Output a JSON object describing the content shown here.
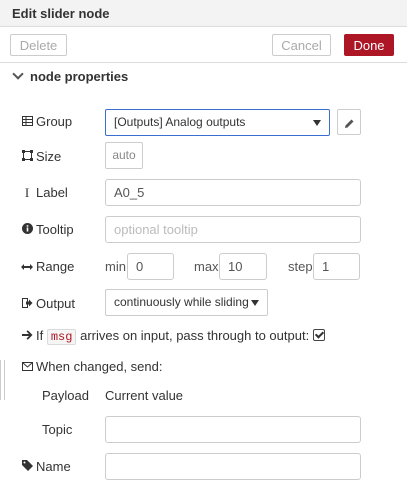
{
  "tray": {
    "title": "Edit slider node"
  },
  "toolbar": {
    "delete_label": "Delete",
    "cancel_label": "Cancel",
    "done_label": "Done"
  },
  "section": {
    "title": "node properties"
  },
  "fields": {
    "group": {
      "label": "Group",
      "value": "[Outputs] Analog outputs"
    },
    "size": {
      "label": "Size",
      "value": "auto"
    },
    "label": {
      "label": "Label",
      "value": "A0_5"
    },
    "tooltip": {
      "label": "Tooltip",
      "placeholder": "optional tooltip"
    },
    "range": {
      "label": "Range",
      "min_label": "min",
      "min_value": "0",
      "max_label": "max",
      "max_value": "10",
      "step_label": "step",
      "step_value": "1"
    },
    "output": {
      "label": "Output",
      "value": "continuously while sliding"
    },
    "passthrough": {
      "prefix": "If",
      "code": "msg",
      "suffix": "arrives on input, pass through to output:",
      "checked": true
    },
    "when_changed": {
      "label": "When changed, send:"
    },
    "payload": {
      "label": "Payload",
      "value": "Current value"
    },
    "topic": {
      "label": "Topic",
      "value": ""
    },
    "name": {
      "label": "Name",
      "value": ""
    }
  }
}
